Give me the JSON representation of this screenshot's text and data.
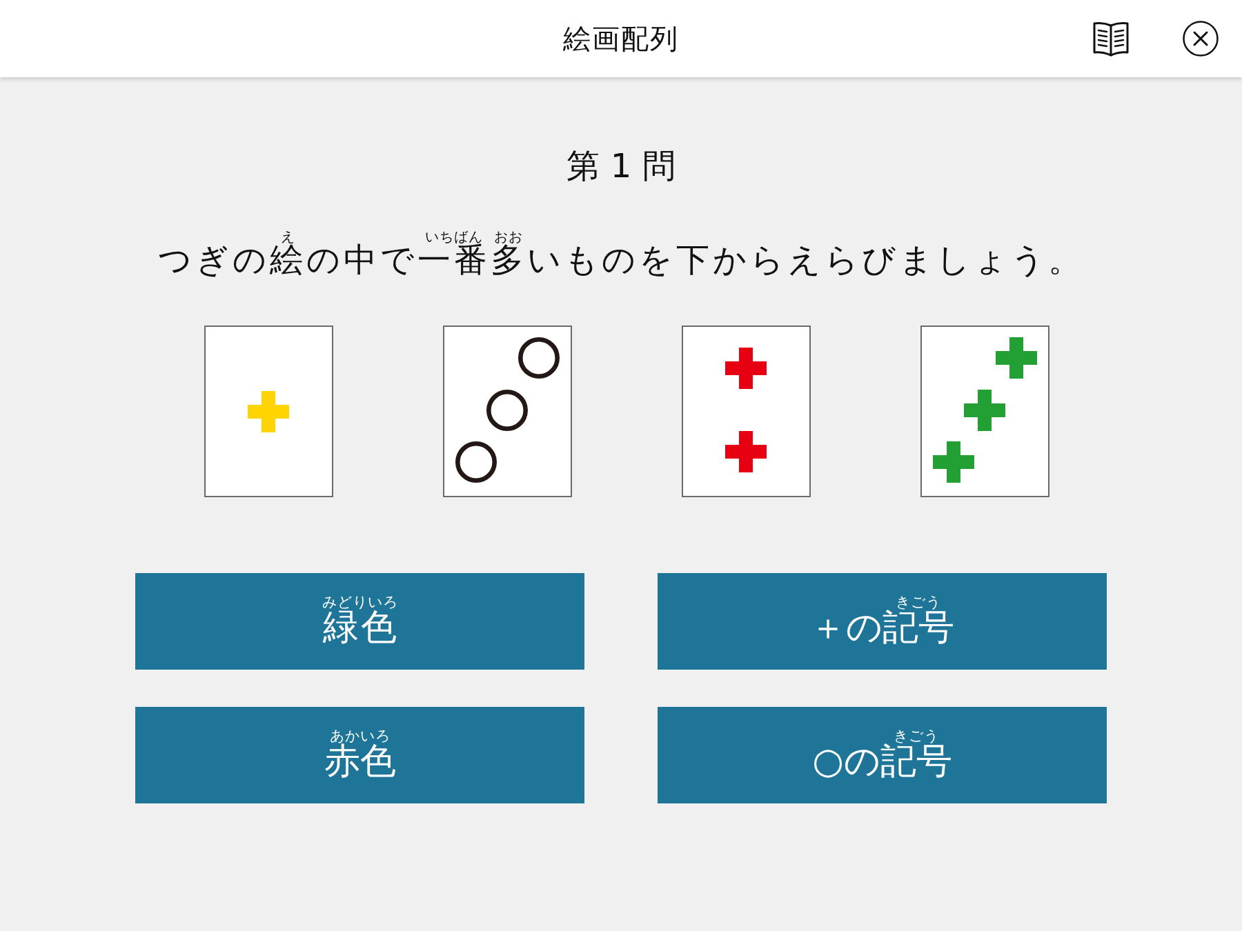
{
  "header": {
    "title": "絵画配列"
  },
  "question_number": "第 1 問",
  "question": [
    {
      "text": "つぎの"
    },
    {
      "text": "絵",
      "ruby": "え"
    },
    {
      "text": "の中で"
    },
    {
      "text": "一番",
      "ruby": "いちばん"
    },
    {
      "text": "多",
      "ruby": "おお"
    },
    {
      "text": "いものを下からえらびましょう。"
    }
  ],
  "cards": [
    {
      "symbols": [
        {
          "kind": "plus",
          "color": "#ffd400"
        }
      ]
    },
    {
      "symbols": [
        {
          "kind": "ring",
          "color": "#231815"
        },
        {
          "kind": "ring",
          "color": "#231815"
        },
        {
          "kind": "ring",
          "color": "#231815"
        }
      ]
    },
    {
      "symbols": [
        {
          "kind": "plus",
          "color": "#e60012"
        },
        {
          "kind": "plus",
          "color": "#e60012"
        }
      ]
    },
    {
      "symbols": [
        {
          "kind": "plus",
          "color": "#22a033"
        },
        {
          "kind": "plus",
          "color": "#22a033"
        },
        {
          "kind": "plus",
          "color": "#22a033"
        }
      ]
    }
  ],
  "choices": [
    {
      "label": [
        {
          "text": "緑色",
          "ruby": "みどりいろ"
        }
      ]
    },
    {
      "label": [
        {
          "text": "＋の"
        },
        {
          "text": "記号",
          "ruby": "きごう"
        }
      ]
    },
    {
      "label": [
        {
          "text": "赤色",
          "ruby": "あかいろ"
        }
      ]
    },
    {
      "label": [
        {
          "text": "○の"
        },
        {
          "text": "記号",
          "ruby": "きごう"
        }
      ]
    }
  ]
}
